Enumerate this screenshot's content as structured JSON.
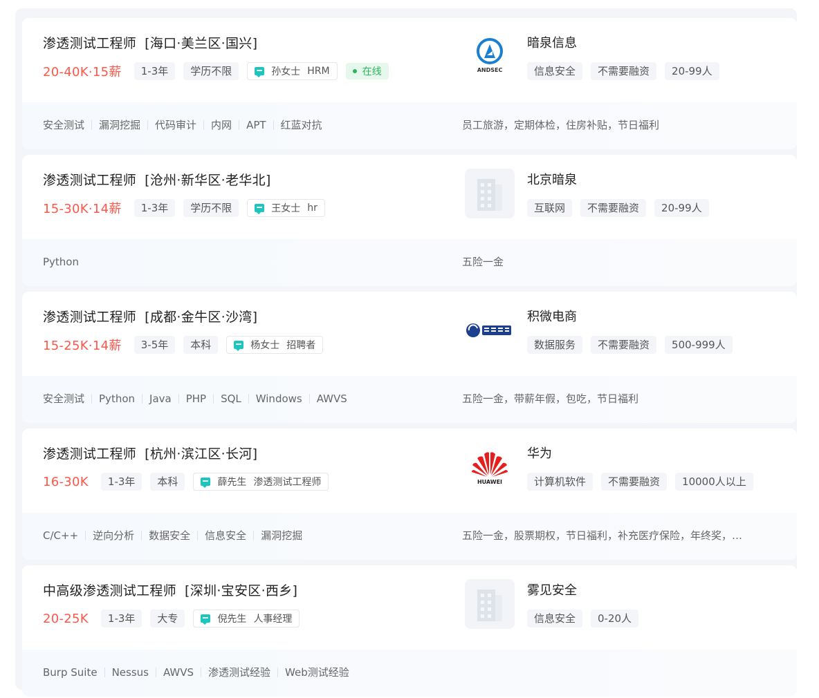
{
  "jobs": [
    {
      "title": "渗透测试工程师",
      "area": "[海口·美兰区·国兴]",
      "salary": "20-40K·15薪",
      "tags": [
        "1-3年",
        "学历不限"
      ],
      "recruiter": {
        "name": "孙女士",
        "role": "HRM"
      },
      "status": "在线",
      "skills": [
        "安全测试",
        "漏洞挖掘",
        "代码审计",
        "内网",
        "APT",
        "红蓝对抗"
      ],
      "company": {
        "name": "暗泉信息",
        "logo": "andsec-logo",
        "logo_text": "ANDSEC",
        "tags": [
          "信息安全",
          "不需要融资",
          "20-99人"
        ]
      },
      "welfare": "员工旅游，定期体检，住房补贴，节日福利"
    },
    {
      "title": "渗透测试工程师",
      "area": "[沧州·新华区·老华北]",
      "salary": "15-30K·14薪",
      "tags": [
        "1-3年",
        "学历不限"
      ],
      "recruiter": {
        "name": "王女士",
        "role": "hr"
      },
      "skills": [
        "Python"
      ],
      "company": {
        "name": "北京暗泉",
        "logo": "building-placeholder-icon",
        "tags": [
          "互联网",
          "不需要融资",
          "20-99人"
        ]
      },
      "welfare": "五险一金"
    },
    {
      "title": "渗透测试工程师",
      "area": "[成都·金牛区·沙湾]",
      "salary": "15-25K·14薪",
      "tags": [
        "3-5年",
        "本科"
      ],
      "recruiter": {
        "name": "杨女士",
        "role": "招聘者"
      },
      "skills": [
        "安全测试",
        "Python",
        "Java",
        "PHP",
        "SQL",
        "Windows",
        "AWVS"
      ],
      "company": {
        "name": "积微电商",
        "logo": "jiwei-logo",
        "tags": [
          "数据服务",
          "不需要融资",
          "500-999人"
        ]
      },
      "welfare": "五险一金，带薪年假，包吃，节日福利"
    },
    {
      "title": "渗透测试工程师",
      "area": "[杭州·滨江区·长河]",
      "salary": "16-30K",
      "tags": [
        "1-3年",
        "本科"
      ],
      "recruiter": {
        "name": "薛先生",
        "role": "渗透测试工程师"
      },
      "skills": [
        "C/C++",
        "逆向分析",
        "数据安全",
        "信息安全",
        "漏洞挖掘"
      ],
      "company": {
        "name": "华为",
        "logo": "huawei-logo",
        "logo_text": "HUAWEI",
        "tags": [
          "计算机软件",
          "不需要融资",
          "10000人以上"
        ]
      },
      "welfare": "五险一金，股票期权，节日福利，补充医疗保险，年终奖，…"
    },
    {
      "title": "中高级渗透测试工程师",
      "area": "[深圳·宝安区·西乡]",
      "salary": "20-25K",
      "tags": [
        "1-3年",
        "大专"
      ],
      "recruiter": {
        "name": "倪先生",
        "role": "人事经理"
      },
      "skills": [
        "Burp Suite",
        "Nessus",
        "AWVS",
        "渗透测试经验",
        "Web测试经验"
      ],
      "company": {
        "name": "雾见安全",
        "logo": "building-placeholder-icon",
        "tags": [
          "信息安全",
          "0-20人"
        ]
      },
      "welfare": ""
    }
  ],
  "colors": {
    "salary": "#fe574a",
    "online": "#2db55d",
    "chat": "#1bc6be",
    "huawei": "#e3201e",
    "andsec": "#1a7fd0"
  }
}
